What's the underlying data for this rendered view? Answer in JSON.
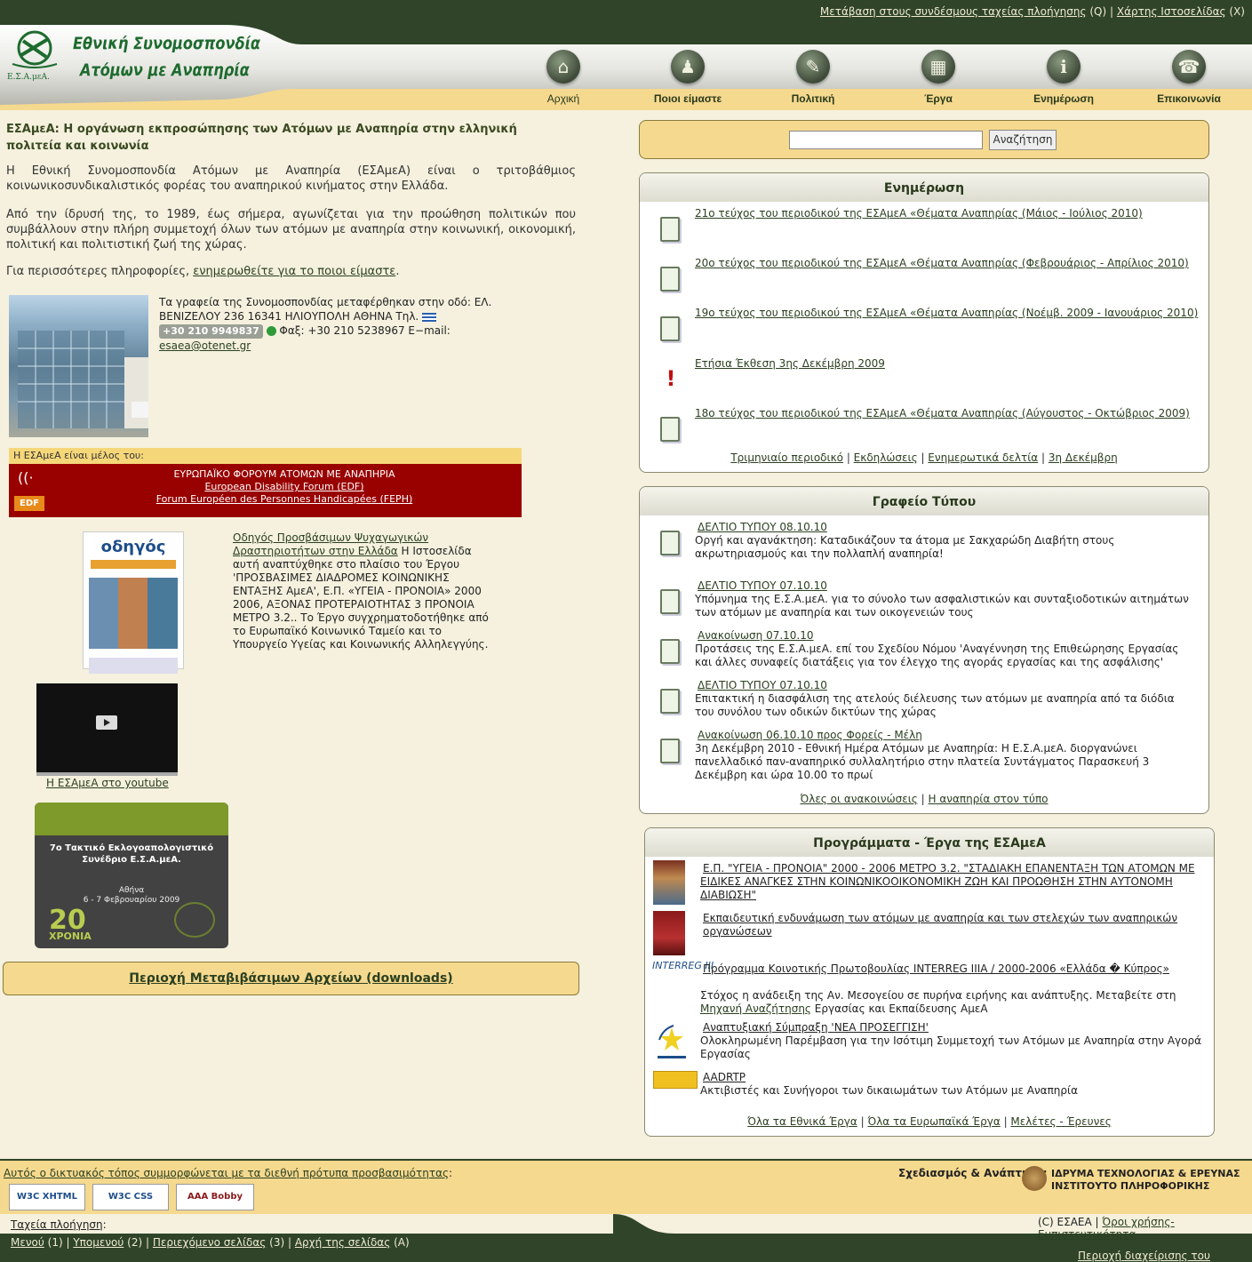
{
  "top_links": {
    "quick_nav": "Μετάβαση στους συνδέσμους ταχείας πλοήγησης",
    "quick_nav_key": "(Q)",
    "sep": "|",
    "sitemap": "Χάρτης Ιστοσελίδας",
    "sitemap_key": "(X)"
  },
  "logo": {
    "line1": "Εθνική Συνομοσπονδία",
    "line2": "Ατόμων με Αναπηρία",
    "mark_text": "Ε.Σ.Α.μεΑ."
  },
  "nav": [
    {
      "label": "Αρχική",
      "icon": "home-icon",
      "glyph": "⌂"
    },
    {
      "label": "Ποιοι είμαστε",
      "icon": "people-icon",
      "glyph": "♟"
    },
    {
      "label": "Πολιτική",
      "icon": "politics-icon",
      "glyph": "✎"
    },
    {
      "label": "Έργα",
      "icon": "projects-icon",
      "glyph": "▦"
    },
    {
      "label": "Ενημέρωση",
      "icon": "info-icon",
      "glyph": "i"
    },
    {
      "label": "Επικοινωνία",
      "icon": "phone-icon",
      "glyph": "☎"
    }
  ],
  "intro": {
    "title": "ΕΣΑμεΑ: Η οργάνωση εκπροσώπησης των Ατόμων με Αναπηρία στην ελληνική πολιτεία και κοινωνία",
    "p1": "Η Εθνική Συνομοσπονδία Ατόμων με Αναπηρία (ΕΣΑμεΑ) είναι ο τριτοβάθμιος κοινωνικοσυνδικαλιστικός φορέας του αναπηρικού κινήματος στην Ελλάδα.",
    "p2": "Από την ίδρυσή της, το 1989, έως σήμερα, αγωνίζεται για την προώθηση πολιτικών που συμβάλλουν στην πλήρη συμμετοχή όλων των ατόμων με αναπηρία στην κοινωνική, οικονομική, πολιτική και πολιτιστική ζωή της χώρας.",
    "p3_prefix": "Για περισσότερες πληροφορίες,",
    "p3_link": "ενημερωθείτε για το ποιοι είμαστε",
    "p3_suffix": "."
  },
  "office": {
    "text1": "Τα γραφεία της Συνομοσπονδίας μεταφέρθηκαν στην οδό: ΕΛ. ΒΕΝΙΖΕΛΟΥ 236 16341 ΗΛΙΟΥΠΟΛΗ ΑΘΗΝΑ Τηλ.",
    "phone": "+30 210 9949837",
    "fax_label": "Φαξ:",
    "fax": "+30 210 5238967 E−mail:",
    "email": "esaea@otenet.gr"
  },
  "member": {
    "header": "Η ΕΣΑμεΑ είναι μέλος του:",
    "line1": "ΕΥΡΩΠΑΪΚΟ ΦΟΡΟΥΜ ΑΤΟΜΩΝ ΜΕ ΑΝΑΠΗΡΙΑ",
    "line2": "European Disability Forum (EDF)",
    "line3": "Forum Européen des Personnes Handicapées (FEPH)",
    "logo": "EDF"
  },
  "guide": {
    "cover_title": "οδηγός",
    "link": "Οδηγός Προσβάσιμων Ψυχαγωγικών Δραστηριοτήτων στην Ελλάδα",
    "text": "Η Ιστοσελίδα αυτή αναπτύχθηκε στο πλαίσιο του Έργου 'ΠΡΟΣΒΑΣΙΜΕΣ ΔΙΑΔΡΟΜΕΣ ΚΟΙΝΩΝΙΚΗΣ ΕΝΤΑΞΗΣ ΑμεΑ', Ε.Π. «ΥΓΕΙΑ - ΠΡΟΝΟΙΑ» 2000 2006, ΑΞΟΝΑΣ ΠΡΟΤΕΡΑΙΟΤΗΤΑΣ 3 ΠΡΟΝΟΙΑ ΜΕΤΡΟ 3.2.. Το Έργο συγχρηματοδοτήθηκε από το Ευρωπαϊκό Κοινωνικό Ταμείο και το Υπουργείο Υγείας και Κοινωνικής Αλληλεγγύης."
  },
  "youtube": {
    "link": "Η ΕΣΑμεΑ στο youtube"
  },
  "congress": {
    "title": "7ο Τακτικό Εκλογοαπολογιστικό Συνέδριο Ε.Σ.Α.μεΑ.",
    "place": "Αθήνα",
    "date": "6 - 7 Φεβρουαρίου 2009",
    "years": "20",
    "years_label": "ΧΡΟΝΙΑ"
  },
  "downloads": {
    "label": "Περιοχή Μεταβιβάσιμων Αρχείων (downloads)"
  },
  "search": {
    "button": "Αναζήτηση",
    "value": ""
  },
  "news": {
    "title": "Ενημέρωση",
    "items": [
      "21ο τεύχος του περιοδικού της ΕΣΑμεΑ «Θέματα Αναπηρίας (Μάιος - Ιούλιος 2010)",
      "20ο τεύχος του περιοδικού της ΕΣΑμεΑ «Θέματα Αναπηρίας (Φεβρουάριος - Απρίλιος 2010)",
      "19ο τεύχος του περιοδικού της ΕΣΑμεΑ «Θέματα Αναπηρίας (Νοέμβ. 2009 - Ιανουάριος 2010)",
      "Ετήσια Έκθεση 3ης Δεκέμβρη 2009",
      "18ο τεύχος του περιοδικού της ΕΣΑμεΑ «Θέματα Αναπηρίας (Αύγουστος - Οκτώβριος 2009)"
    ],
    "footer": [
      "Τριμηνιαίο περιοδικό",
      "Εκδηλώσεις",
      "Ενημερωτικά δελτία",
      "3η Δεκέμβρη"
    ]
  },
  "press": {
    "title": "Γραφείο Τύπου",
    "items": [
      {
        "date": "ΔΕΛΤΙΟ ΤΥΠΟΥ 08.10.10",
        "text": "Οργή και αγανάκτηση: Καταδικάζουν τα άτομα με Σακχαρώδη Διαβήτη στους ακρωτηριασμούς και την πολλαπλή αναπηρία!"
      },
      {
        "date": "ΔΕΛΤΙΟ ΤΥΠΟΥ 07.10.10",
        "text": "Υπόμνημα της Ε.Σ.Α.μεΑ. για το σύνολο των ασφαλιστικών και συνταξιοδοτικών αιτημάτων των ατόμων με αναπηρία και των οικογενειών τους"
      },
      {
        "date": "Ανακοίνωση 07.10.10",
        "text": "Προτάσεις της Ε.Σ.Α.μεΑ. επί του Σχεδίου Νόμου 'Αναγέννηση της Επιθεώρησης Εργασίας και άλλες συναφείς διατάξεις για τον έλεγχο της αγοράς εργασίας και της ασφάλισης'"
      },
      {
        "date": "ΔΕΛΤΙΟ ΤΥΠΟΥ 07.10.10",
        "text": "Επιτακτική η διασφάλιση της ατελούς διέλευσης των ατόμων με αναπηρία από τα διόδια του συνόλου των οδικών δικτύων της χώρας"
      },
      {
        "date": "Ανακοίνωση 06.10.10 προς Φορείς - Μέλη",
        "text": "3η Δεκέμβρη 2010 - Εθνική Ημέρα Ατόμων με Αναπηρία: Η Ε.Σ.Α.μεΑ. διοργανώνει πανελλαδικό παν-αναπηρικό συλλαλητήριο στην πλατεία Συντάγματος Παρασκευή 3 Δεκέμβρη και ώρα 10.00 το πρωί"
      }
    ],
    "footer": [
      "Όλες οι ανακοινώσεις",
      "Η αναπηρία στον τύπο"
    ]
  },
  "programs": {
    "title": "Προγράμματα - Έργα της ΕΣΑμεΑ",
    "items": [
      {
        "link": "Ε.Π. \"ΥΓΕΙΑ - ΠΡΟΝΟΙΑ\" 2000 - 2006 ΜΕΤΡΟ 3.2. \"ΣΤΑΔΙΑΚΗ ΕΠΑΝΕΝΤΑΞΗ ΤΩΝ ΑΤΟΜΩΝ ΜΕ ΕΙΔΙΚΕΣ ΑΝΑΓΚΕΣ ΣΤΗΝ ΚΟΙΝΩΝΙΚΟΟΙΚΟΝΟΜΙΚΗ ΖΩΗ ΚΑΙ ΠΡΟΩΘΗΣΗ ΣΤΗΝ ΑΥΤΟΝΟΜΗ ΔΙΑΒΙΩΣΗ\"",
        "text": ""
      },
      {
        "link": "Εκπαιδευτική ενδυνάμωση των ατόμων με αναπηρία και των στελεχών των αναπηρικών οργανώσεων",
        "text": ""
      },
      {
        "link": "Πρόγραμμα Κοινοτικής Πρωτοβουλίας INTERREG IIIA / 2000-2006 «Ελλάδα � Κύπρος»",
        "text": "Στόχος η ανάδειξη της Αν. Μεσογείου σε πυρήνα ειρήνης και ανάπτυξης. Μεταβείτε στη",
        "text_link": "Μηχανή Αναζήτησης",
        "text2": "Εργασίας και Εκπαίδευσης ΑμεΑ",
        "logo": "INTERREG III"
      },
      {
        "link": "Αναπτυξιακή Σύμπραξη 'ΝΕΑ ΠΡΟΣΕΓΓΙΣΗ'",
        "text": "Ολοκληρωμένη Παρέμβαση για την Ισότιμη Συμμετοχή των Ατόμων με Αναπηρία στην Αγορά Εργασίας"
      },
      {
        "link": "AADRTP",
        "text": "Ακτιβιστές και Συνήγοροι των δικαιωμάτων των Ατόμων με Αναπηρία"
      }
    ],
    "footer": [
      "Όλα τα Εθνικά Έργα",
      "Όλα τα Ευρωπαϊκά Έργα",
      "Μελέτες - Έρευνες"
    ]
  },
  "footer": {
    "accessibility": "Αυτός ο δικτυακός τόπος συμμορφώνεται με τα διεθνή πρότυπα προσβασιμότητας",
    "colon": ":",
    "badges": [
      "W3C XHTML 1.0",
      "W3C CSS",
      "AAA Bobby APPROVED"
    ],
    "design_label": "Σχεδιασμός & Ανάπτυξη:",
    "iti_line1": "ΙΔΡΥΜΑ ΤΕΧΝΟΛΟΓΙΑΣ & ΕΡΕΥΝΑΣ",
    "iti_line2": "ΙΝΣΤΙΤΟΥΤΟ ΠΛΗΡΟΦΟΡΙΚΗΣ",
    "quick_nav_label": "Ταχεία πλοήγηση",
    "menu": "Μενού",
    "menu_key": "(1)",
    "submenu": "Υπομενού",
    "submenu_key": "(2)",
    "content": "Περιεχόμενο σελίδας",
    "content_key": "(3)",
    "top": "Αρχή της σελίδας",
    "top_key": "(A)",
    "copyright": "(C) ΕΣΑΕΑ |",
    "terms": "Όροι χρήσης-Εμπιστευτικότητα",
    "admin": "Περιοχή διαχείρισης του esaea.gr"
  }
}
